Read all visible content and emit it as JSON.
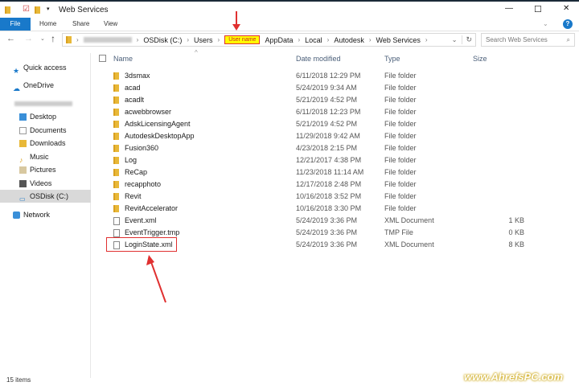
{
  "window": {
    "title": "Web Services",
    "minimize": "—",
    "maximize": "☐",
    "close": "✕",
    "help": "?"
  },
  "ribbon": {
    "tabs": [
      "File",
      "Home",
      "Share",
      "View"
    ]
  },
  "address": {
    "crumbs": [
      "(blurred)",
      "OSDisk (C:)",
      "Users",
      "User name",
      "AppData",
      "Local",
      "Autodesk",
      "Web Services"
    ],
    "highlight": "User name"
  },
  "search": {
    "placeholder": "Search Web Services"
  },
  "sidebar": {
    "items": [
      {
        "label": "Quick access",
        "icon": "star-icon"
      },
      {
        "label": "OneDrive",
        "icon": "cloud-icon"
      },
      {
        "label": "",
        "icon": "user-pc-icon"
      },
      {
        "label": "Desktop",
        "icon": "desktop-icon"
      },
      {
        "label": "Documents",
        "icon": "documents-icon"
      },
      {
        "label": "Downloads",
        "icon": "downloads-icon"
      },
      {
        "label": "Music",
        "icon": "music-icon"
      },
      {
        "label": "Pictures",
        "icon": "pictures-icon"
      },
      {
        "label": "Videos",
        "icon": "videos-icon"
      },
      {
        "label": "OSDisk (C:)",
        "icon": "drive-icon",
        "selected": true
      },
      {
        "label": "Network",
        "icon": "network-icon"
      }
    ]
  },
  "columns": [
    "Name",
    "Date modified",
    "Type",
    "Size"
  ],
  "files": [
    {
      "name": "3dsmax",
      "date": "6/11/2018 12:29 PM",
      "type": "File folder",
      "size": ""
    },
    {
      "name": "acad",
      "date": "5/24/2019 9:34 AM",
      "type": "File folder",
      "size": ""
    },
    {
      "name": "acadlt",
      "date": "5/21/2019 4:52 PM",
      "type": "File folder",
      "size": ""
    },
    {
      "name": "acwebbrowser",
      "date": "6/11/2018 12:23 PM",
      "type": "File folder",
      "size": ""
    },
    {
      "name": "AdskLicensingAgent",
      "date": "5/21/2019 4:52 PM",
      "type": "File folder",
      "size": ""
    },
    {
      "name": "AutodeskDesktopApp",
      "date": "11/29/2018 9:42 AM",
      "type": "File folder",
      "size": ""
    },
    {
      "name": "Fusion360",
      "date": "4/23/2018 2:15 PM",
      "type": "File folder",
      "size": ""
    },
    {
      "name": "Log",
      "date": "12/21/2017 4:38 PM",
      "type": "File folder",
      "size": ""
    },
    {
      "name": "ReCap",
      "date": "11/23/2018 11:14 AM",
      "type": "File folder",
      "size": ""
    },
    {
      "name": "recapphoto",
      "date": "12/17/2018 2:48 PM",
      "type": "File folder",
      "size": ""
    },
    {
      "name": "Revit",
      "date": "10/16/2018 3:52 PM",
      "type": "File folder",
      "size": ""
    },
    {
      "name": "RevitAccelerator",
      "date": "10/16/2018 3:30 PM",
      "type": "File folder",
      "size": ""
    },
    {
      "name": "Event.xml",
      "date": "5/24/2019 3:36 PM",
      "type": "XML Document",
      "size": "1 KB"
    },
    {
      "name": "EventTrigger.tmp",
      "date": "5/24/2019 3:36 PM",
      "type": "TMP File",
      "size": "0 KB"
    },
    {
      "name": "LoginState.xml",
      "date": "5/24/2019 3:36 PM",
      "type": "XML Document",
      "size": "8 KB",
      "highlighted": true
    }
  ],
  "status": {
    "count": "15 items"
  },
  "watermark": "www.AhrefsPC.com",
  "colors": {
    "accent": "#1979ca",
    "annotation": "#e03030",
    "highlight": "#ffff00"
  }
}
